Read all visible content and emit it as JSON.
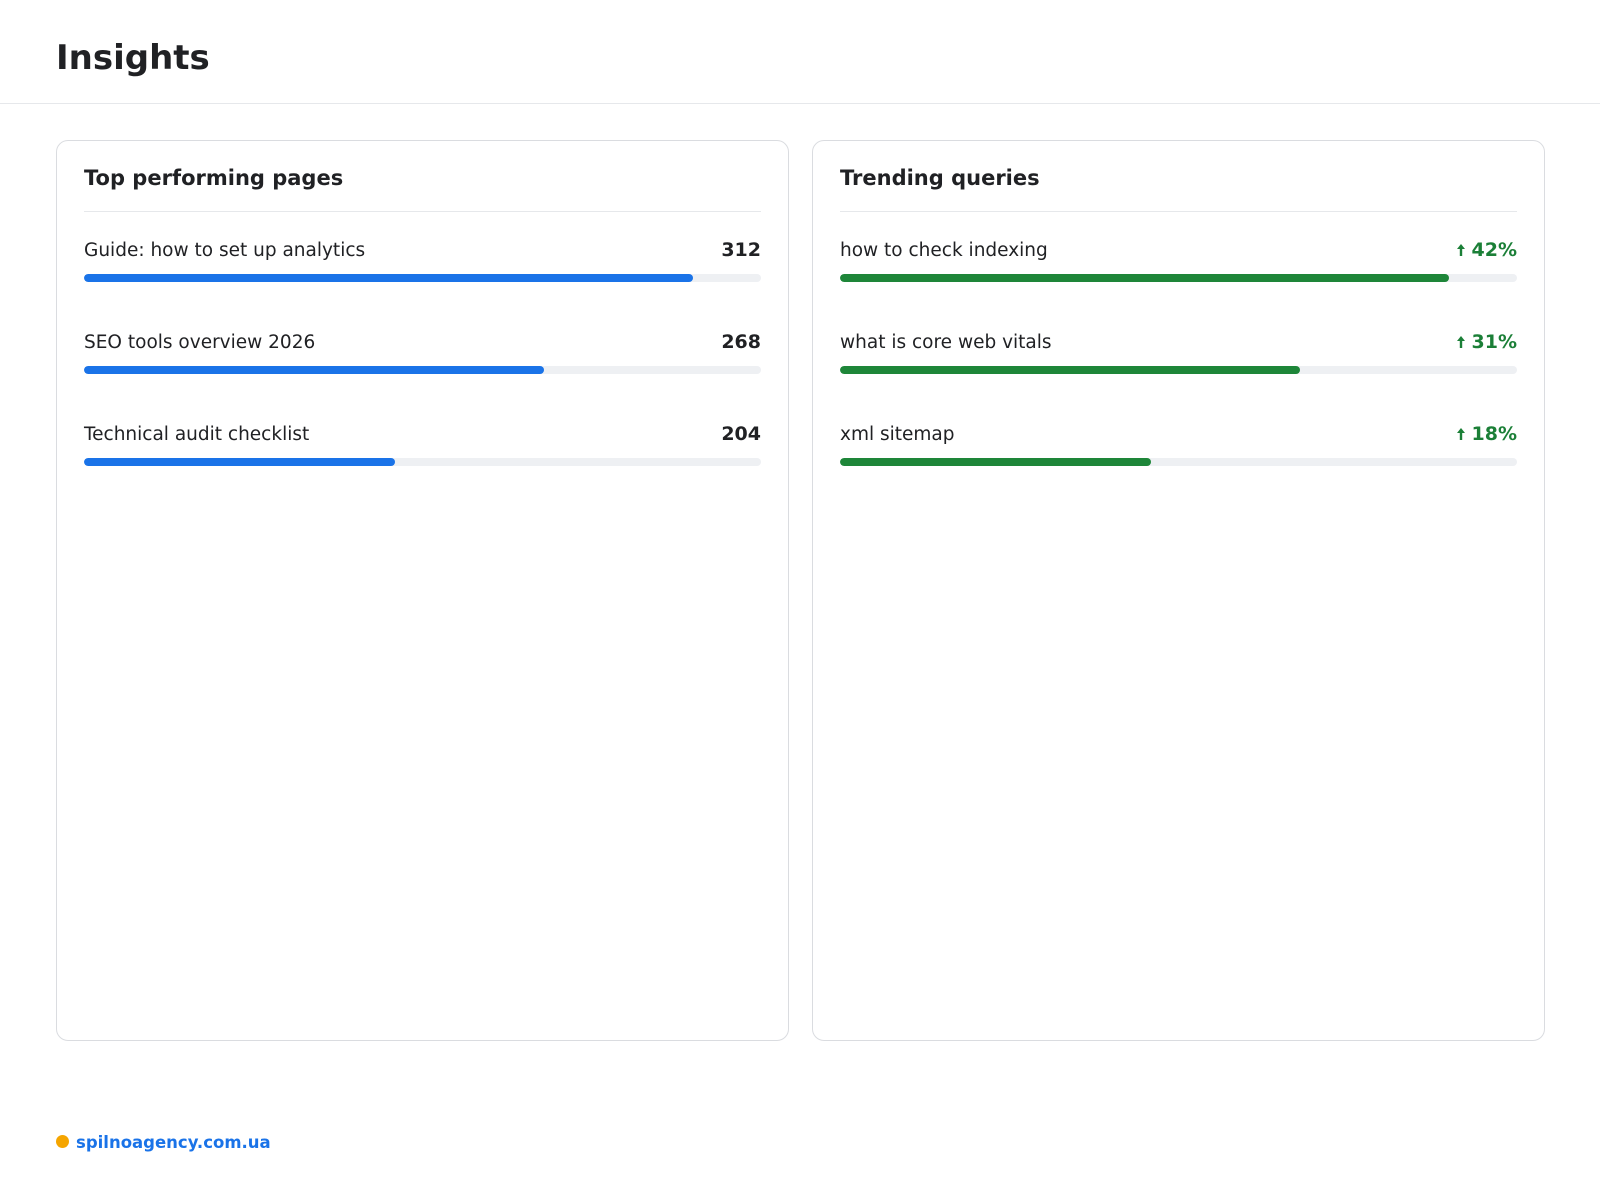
{
  "header": {
    "title": "Insights"
  },
  "colors": {
    "pages_bar": "#1a73e8",
    "queries_bar": "#1e8639",
    "trend_text": "#1b7f37",
    "brand_dot": "#f5a500",
    "brand_link": "#1a73e8"
  },
  "top_pages": {
    "title": "Top performing pages",
    "items": [
      {
        "label": "Guide: how to set up analytics",
        "value": "312",
        "level": 0.9
      },
      {
        "label": "SEO tools overview 2026",
        "value": "268",
        "level": 0.68
      },
      {
        "label": "Technical audit checklist",
        "value": "204",
        "level": 0.46
      }
    ]
  },
  "trending_queries": {
    "title": "Trending queries",
    "trend_icon": "arrow-up-icon",
    "items": [
      {
        "label": "how to check indexing",
        "value": "42%",
        "level": 0.9
      },
      {
        "label": "what is core web vitals",
        "value": "31%",
        "level": 0.68
      },
      {
        "label": "xml sitemap",
        "value": "18%",
        "level": 0.46
      }
    ]
  },
  "footer": {
    "brand_icon": "dot-icon",
    "brand_text": "spilnoagency.com.ua"
  }
}
